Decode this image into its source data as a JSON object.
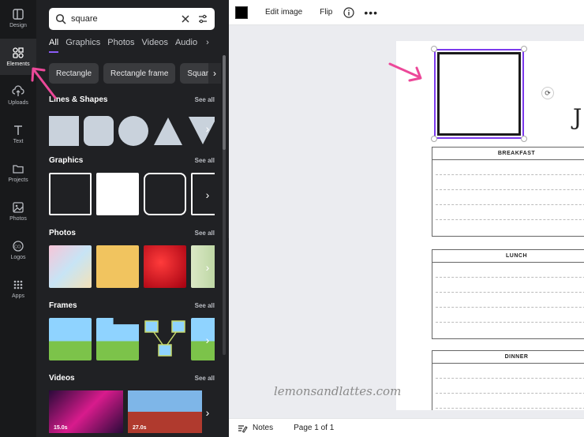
{
  "rail": [
    {
      "label": "Design",
      "icon": "design-icon"
    },
    {
      "label": "Elements",
      "icon": "elements-icon",
      "active": true
    },
    {
      "label": "Uploads",
      "icon": "upload-icon"
    },
    {
      "label": "Text",
      "icon": "text-icon"
    },
    {
      "label": "Projects",
      "icon": "folder-icon"
    },
    {
      "label": "Photos",
      "icon": "photo-icon"
    },
    {
      "label": "Logos",
      "icon": "logo-icon"
    },
    {
      "label": "Apps",
      "icon": "apps-icon"
    }
  ],
  "search": {
    "value": "square"
  },
  "tabs": [
    "All",
    "Graphics",
    "Photos",
    "Videos",
    "Audio"
  ],
  "chips": [
    "Rectangle",
    "Rectangle frame",
    "Square fra"
  ],
  "sections": {
    "lines_shapes": {
      "title": "Lines & Shapes",
      "see_all": "See all"
    },
    "graphics": {
      "title": "Graphics",
      "see_all": "See all"
    },
    "photos": {
      "title": "Photos",
      "see_all": "See all"
    },
    "frames": {
      "title": "Frames",
      "see_all": "See all"
    },
    "videos": {
      "title": "Videos",
      "see_all": "See all",
      "durations": [
        "15.0s",
        "27.0s"
      ]
    }
  },
  "toolbar": {
    "edit_image": "Edit image",
    "flip": "Flip",
    "color": "#000000"
  },
  "planner": {
    "breakfast": "BREAKFAST",
    "lunch": "LUNCH",
    "dinner": "DINNER"
  },
  "watermark": "lemonsandlattes.com",
  "bottom": {
    "notes": "Notes",
    "page": "Page 1 of 1"
  },
  "colors": {
    "accent": "#8b5cf6",
    "annotation_arrow": "#ec4899"
  }
}
